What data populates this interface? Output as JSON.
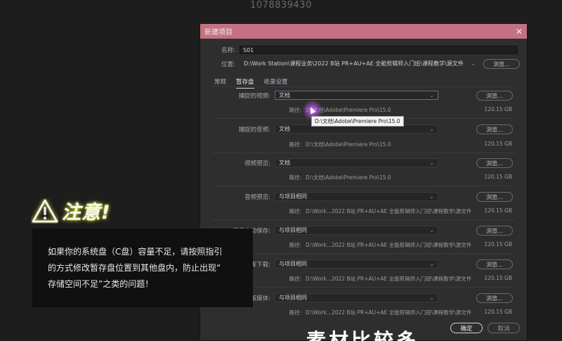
{
  "watermark": "1078839430",
  "dialog": {
    "title": "新建项目",
    "close_icon": "close-icon",
    "name_label": "名称:",
    "name_value": "S01",
    "location_label": "位置:",
    "location_value": "D:\\Work Station\\课程业务\\2022 B站 PR+AU+AE 全能剪辑师入门班\\课程教学\\源文件",
    "location_browse": "浏览...",
    "tabs": [
      {
        "label": "常规",
        "active": false
      },
      {
        "label": "暂存盘",
        "active": true
      },
      {
        "label": "收录设置",
        "active": false
      }
    ],
    "path_key": "路径:",
    "browse": "浏览...",
    "scratch": [
      {
        "label": "捕捉的视频:",
        "value": "文档",
        "path": "D:\\文档\\Adobe\\Premiere Pro\\15.0",
        "size": "120.15 GB"
      },
      {
        "label": "捕捉的音频:",
        "value": "文档",
        "path": "D:\\文档\\Adobe\\Premiere Pro\\15.0",
        "size": "120.15 GB"
      },
      {
        "label": "视频预览:",
        "value": "文档",
        "path": "D:\\文档\\Adobe\\Premiere Pro\\15.0",
        "size": "120.15 GB"
      },
      {
        "label": "音频预览:",
        "value": "与项目相同",
        "path": "D:\\Work...2022 B站 PR+AU+AE 全能剪辑师入门班\\课程教学\\源文件",
        "size": "120.15 GB"
      },
      {
        "label": "项目自动保存:",
        "value": "与项目相同",
        "path": "D:\\Work...2022 B站 PR+AU+AE 全能剪辑师入门班\\课程教学\\源文件",
        "size": "120.15 GB"
      },
      {
        "label": "CC 库下载:",
        "value": "与项目相同",
        "path": "D:\\Work...2022 B站 PR+AU+AE 全能剪辑师入门班\\课程教学\\源文件",
        "size": "120.15 GB"
      },
      {
        "label": "动态图形模板媒体:",
        "value": "与项目相同",
        "path": "D:\\Work...2022 B站 PR+AU+AE 全能剪辑师入门班\\课程教学\\源文件",
        "size": "120.15 GB"
      }
    ],
    "tooltip": "D:\\文档\\Adobe\\Premiere Pro\\15.0",
    "ok": "确定",
    "cancel": "取消"
  },
  "warning": {
    "icon": "warning-triangle-icon",
    "title": "注意!",
    "lines": [
      "如果你的系统盘（C盘）容量不足，请按照指引",
      "的方式修改暂存盘位置到其他盘内，防止出现“",
      "存储空间不足”之类的问题！"
    ]
  },
  "subtitle": "素材比较多"
}
